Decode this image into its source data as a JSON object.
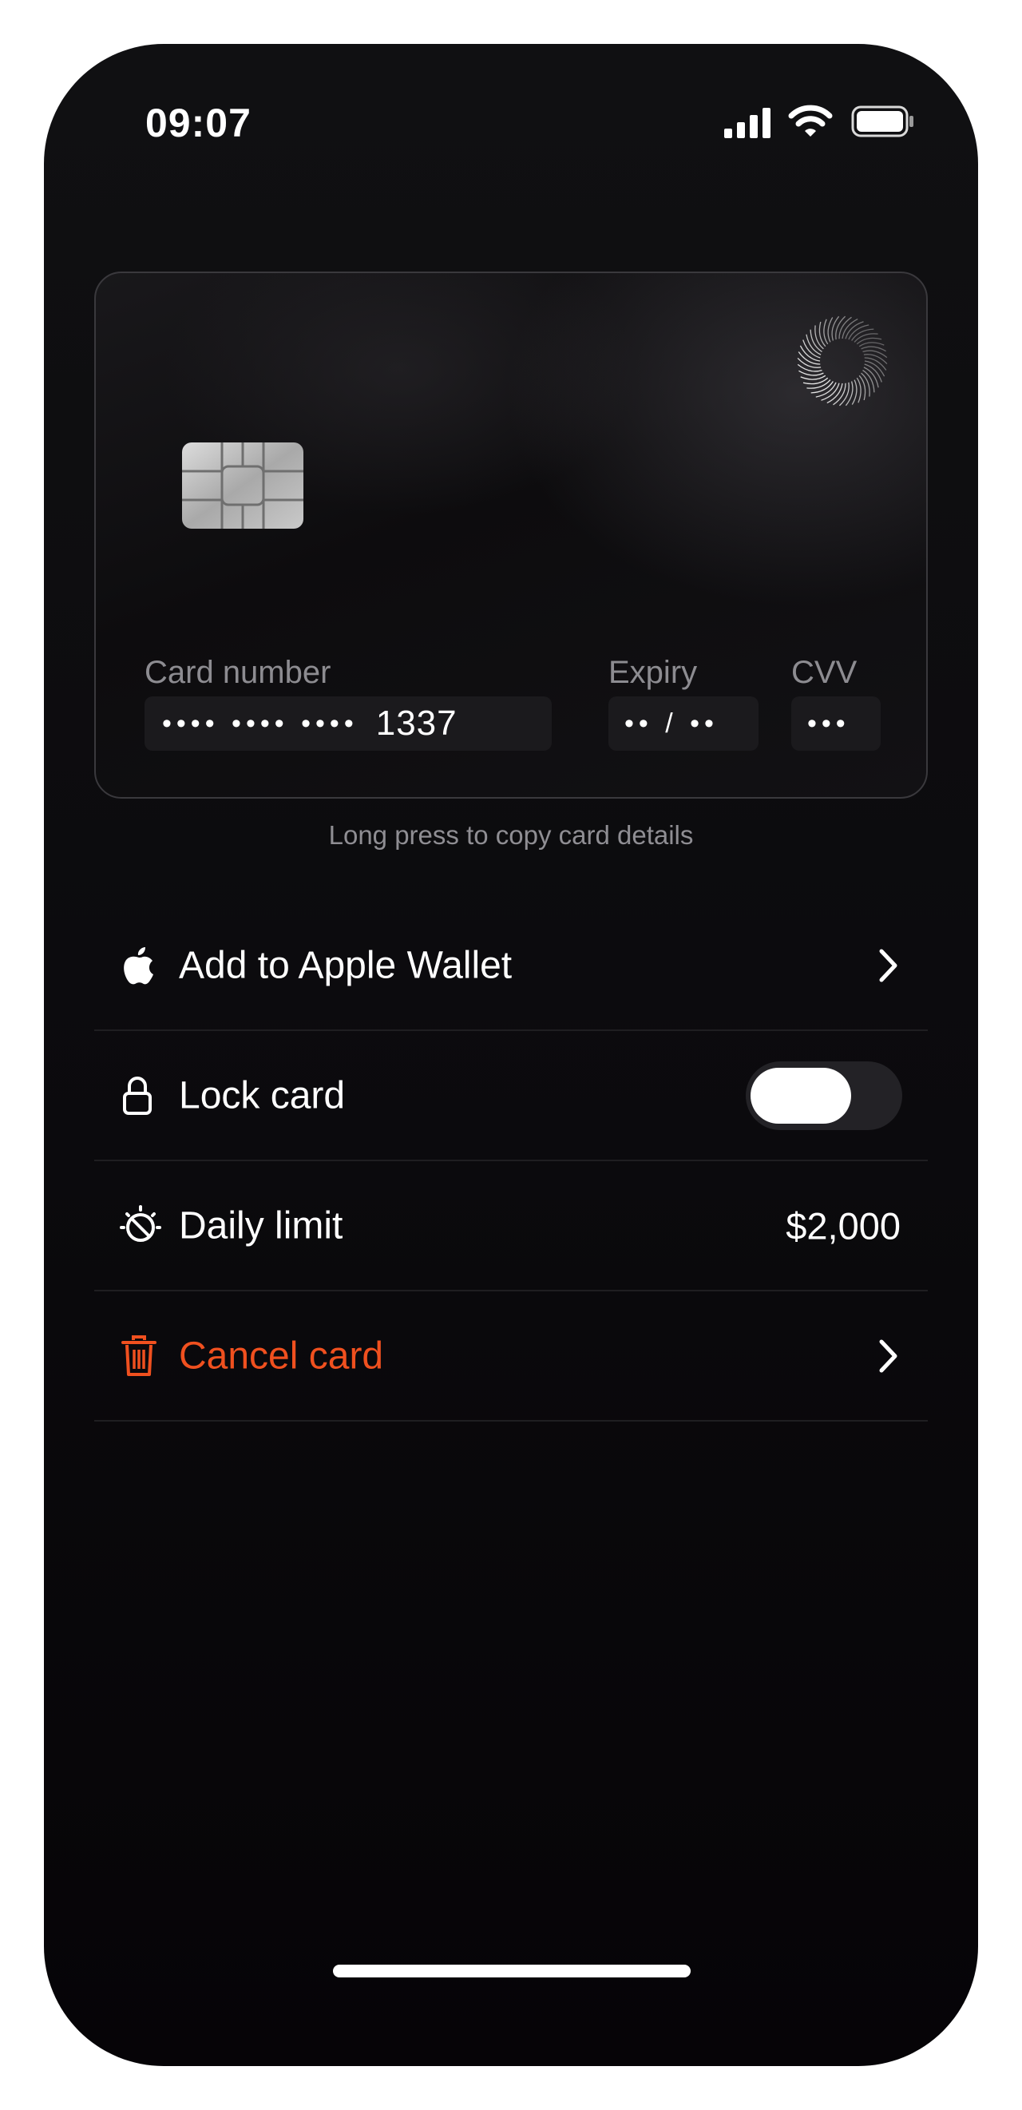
{
  "status_bar": {
    "time": "09:07"
  },
  "card": {
    "number_label": "Card number",
    "number_masked": "•••• •••• ••••",
    "number_last4": "1337",
    "expiry_label": "Expiry",
    "expiry_value": "•• / ••",
    "cvv_label": "CVV",
    "cvv_value": "•••",
    "hint": "Long press to copy card details"
  },
  "actions": [
    {
      "label": "Add to Apple Wallet",
      "icon": "apple-icon",
      "control": "chevron-right-icon"
    },
    {
      "label": "Lock card",
      "icon": "lock-icon",
      "control": "toggle",
      "toggle_on": false
    },
    {
      "label": "Daily limit",
      "icon": "timer-icon",
      "value": "$2,000"
    },
    {
      "label": "Cancel card",
      "icon": "trash-icon",
      "control": "chevron-right-icon",
      "danger_color": "#f0501f"
    }
  ]
}
